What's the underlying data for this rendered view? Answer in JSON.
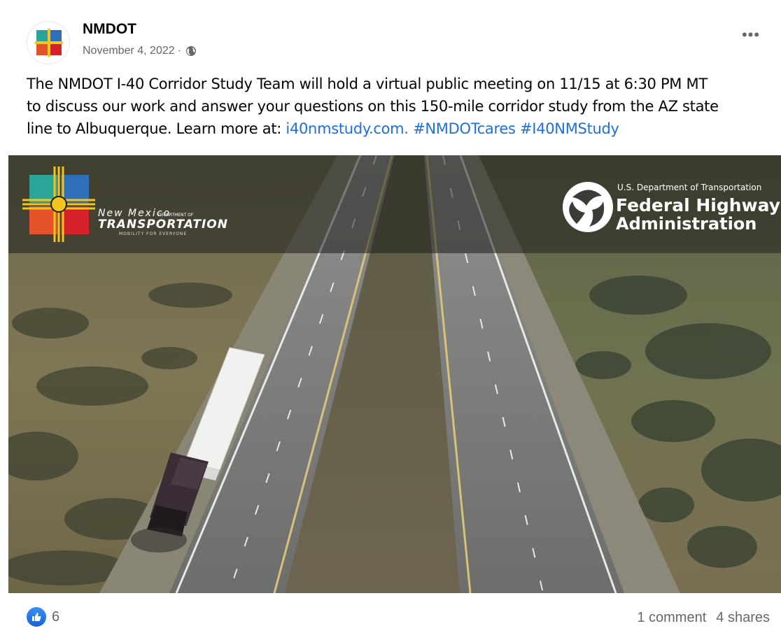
{
  "post": {
    "page_name": "NMDOT",
    "date": "November 4, 2022",
    "separator": "·",
    "more_label": "•••",
    "text_line1": "The NMDOT I-40 Corridor Study Team will hold a virtual public meeting on 11/15 at 6:30 PM MT",
    "text_line2": "to discuss our work and answer your questions on this 150-mile corridor study from the AZ state",
    "text_line3_prefix": "line to Albuquerque. Learn more at: ",
    "link_url": "i40nmstudy.com.",
    "hashtag1": "#NMDOTcares",
    "hashtag2": "#I40NMStudy"
  },
  "image": {
    "nm_logo_line1": "New Mexico",
    "nm_logo_line1b": "DEPARTMENT OF",
    "nm_logo_line2": "TRANSPORTATION",
    "nm_logo_line3": "MOBILITY FOR EVERYONE",
    "fhwa_dept": "U.S. Department of Transportation",
    "fhwa_line1": "Federal Highway",
    "fhwa_line2": "Administration"
  },
  "footer": {
    "reaction_count": "6",
    "comments": "1 comment",
    "shares": "4 shares"
  },
  "colors": {
    "link": "#216fdb",
    "meta_text": "#65676b",
    "like_blue": "#1877f2"
  },
  "icons": {
    "privacy": "globe-icon",
    "reaction": "thumbs-up-icon",
    "menu": "more-options-icon"
  }
}
